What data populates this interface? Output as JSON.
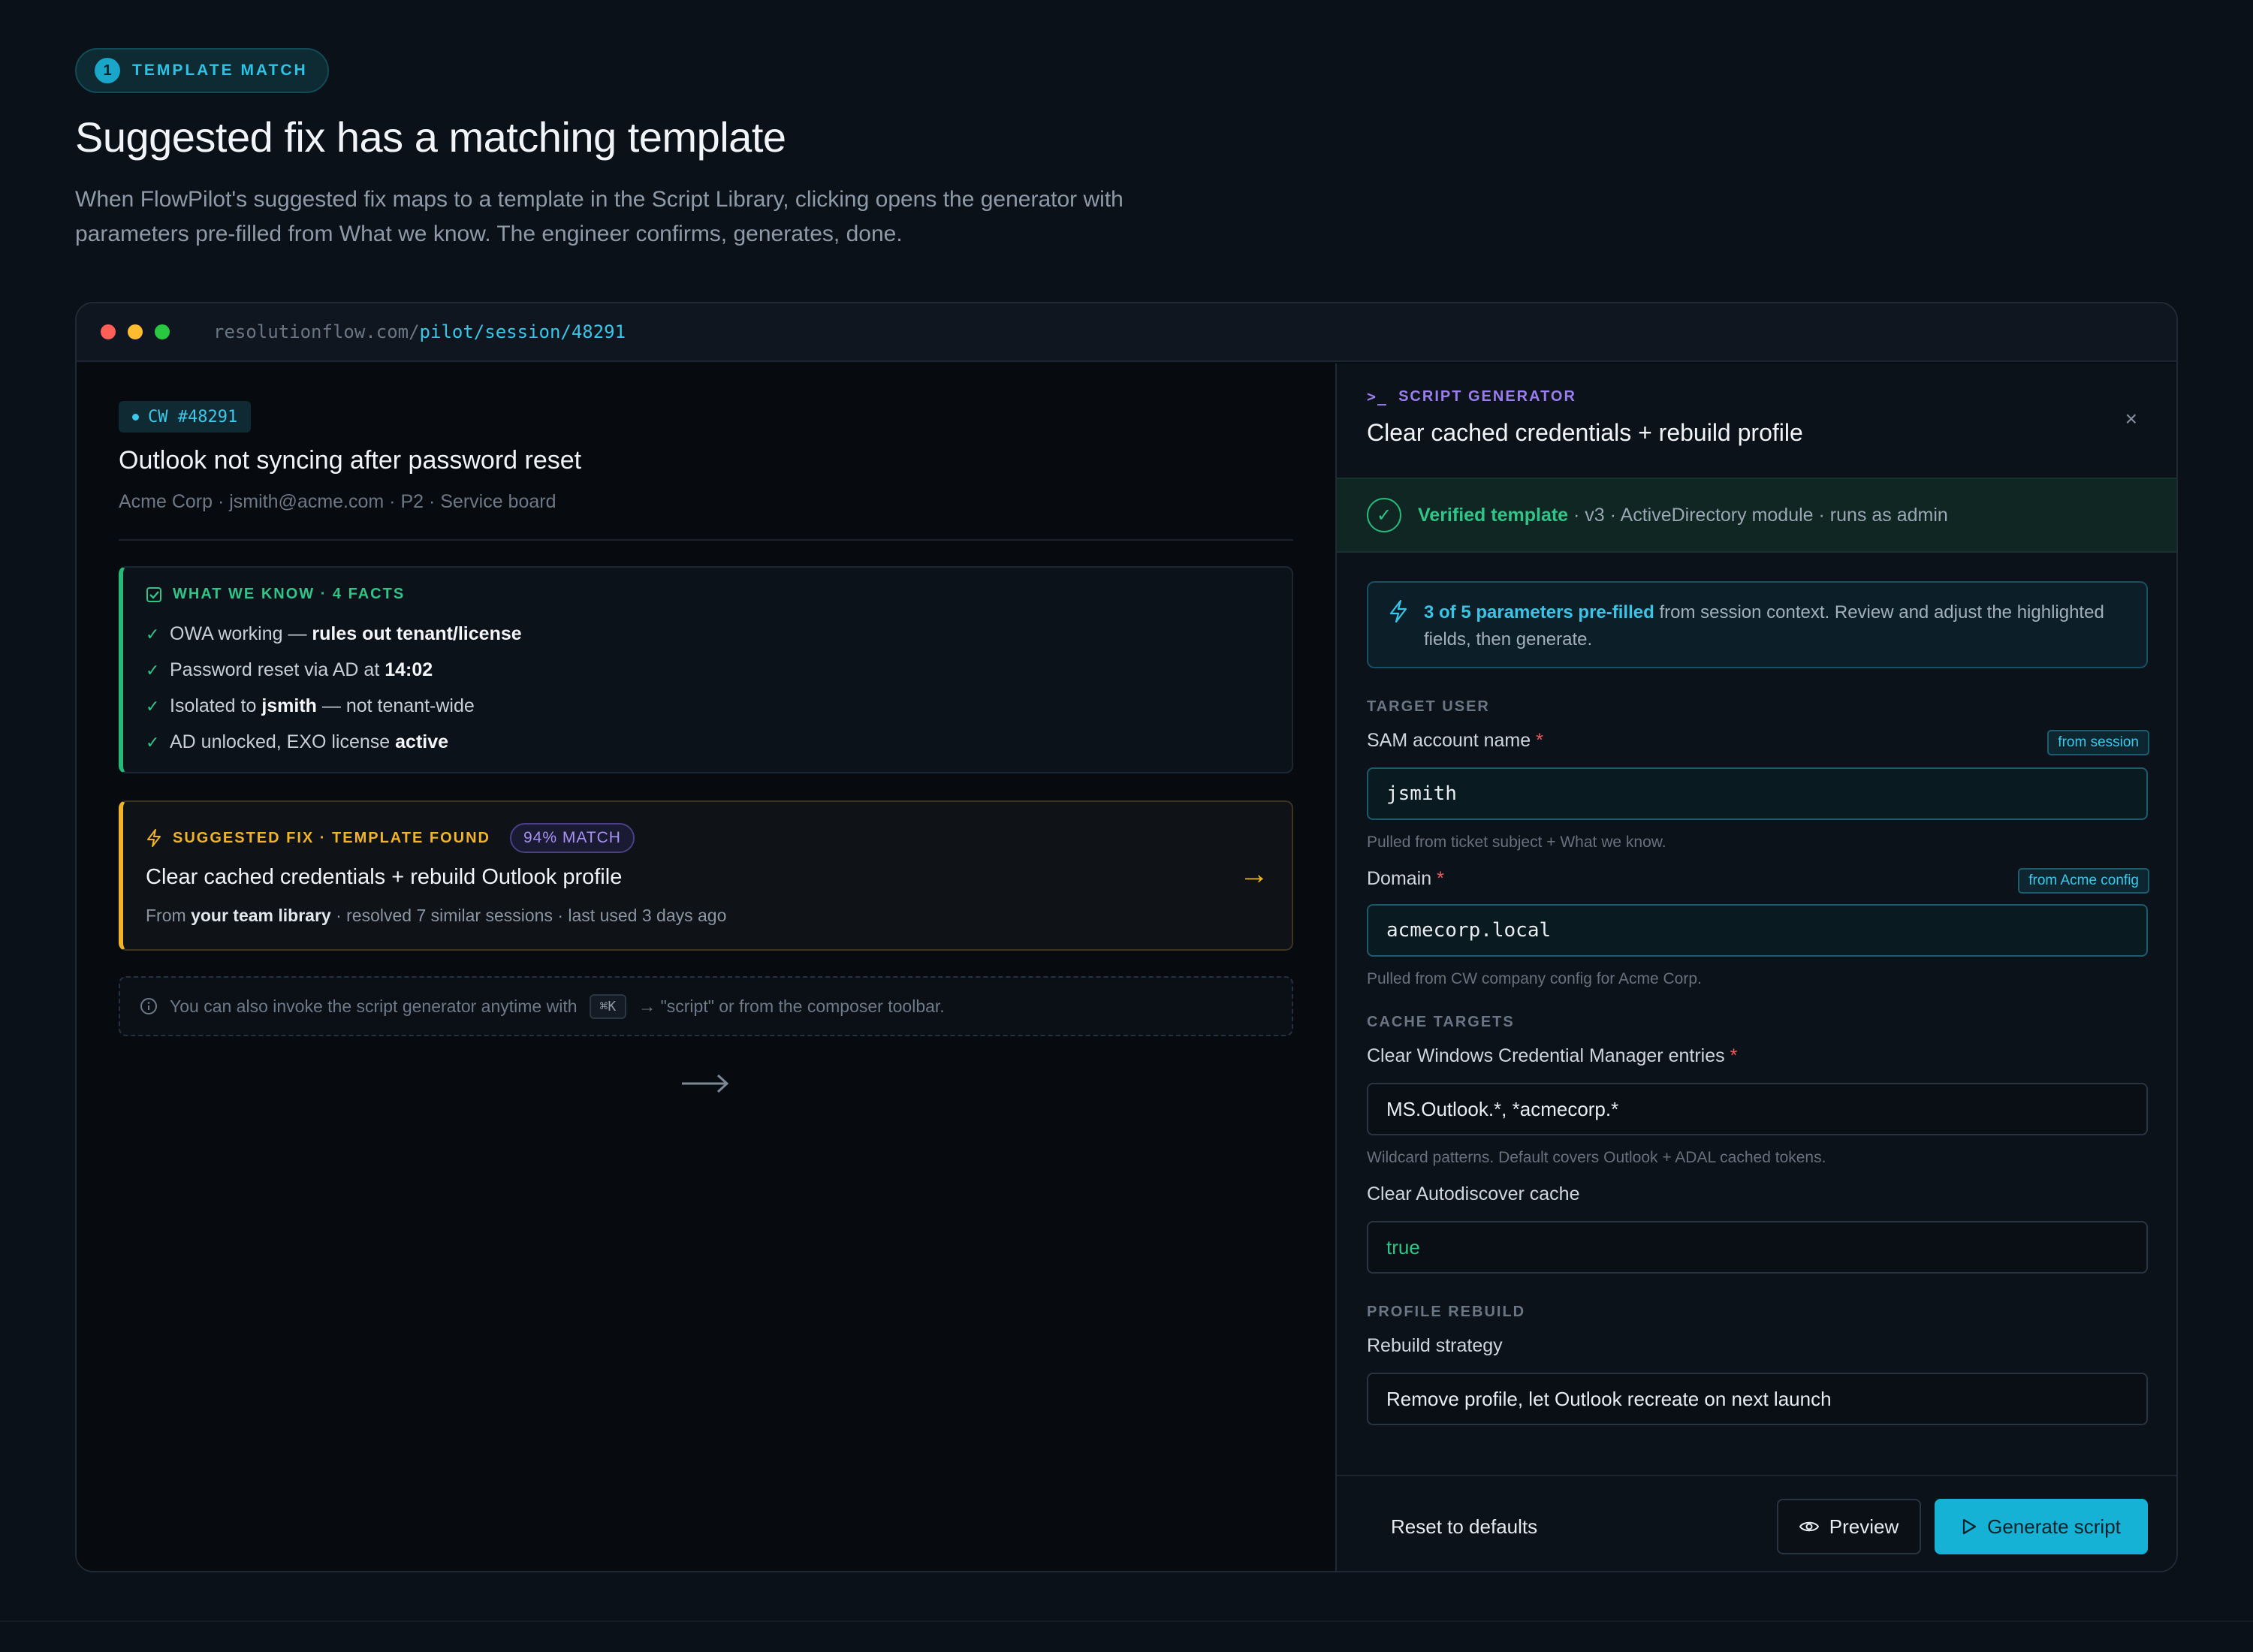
{
  "hero": {
    "step_number": "1",
    "step_label": "TEMPLATE MATCH",
    "title": "Suggested fix has a matching template",
    "description": "When FlowPilot's suggested fix maps to a template in the Script Library, clicking opens the generator with parameters pre-filled from What we know. The engineer confirms, generates, done."
  },
  "browser": {
    "url_host": "resolutionflow.com/",
    "url_path": "pilot/session/48291",
    "dot_colors": [
      "#ff5f57",
      "#febc2e",
      "#28c840"
    ]
  },
  "ticket": {
    "chip": "CW #48291",
    "title": "Outlook not syncing after password reset",
    "meta": "Acme Corp · jsmith@acme.com · P2 · Service board"
  },
  "what_we_know": {
    "heading": "WHAT WE KNOW · 4 FACTS",
    "facts": [
      {
        "text": "OWA working — ",
        "bold": "rules out tenant/license",
        "after": ""
      },
      {
        "text": "Password reset via AD at ",
        "bold": "14:02",
        "after": ""
      },
      {
        "text": "Isolated to ",
        "bold": "jsmith",
        "after": " — not tenant-wide"
      },
      {
        "text": "AD unlocked, EXO license ",
        "bold": "active",
        "after": ""
      }
    ]
  },
  "suggested_fix": {
    "label": "SUGGESTED FIX · TEMPLATE FOUND",
    "match": "94% MATCH",
    "title": "Clear cached credentials + rebuild Outlook profile",
    "meta_prefix": "From ",
    "meta_bold": "your team library",
    "meta_suffix": " · resolved 7 similar sessions · last used 3 days ago",
    "arrow": "→"
  },
  "hint": {
    "prefix": "You can also invoke the script generator anytime with",
    "kbd": "⌘K",
    "suffix": "→ \"script\" or from the composer toolbar."
  },
  "generator": {
    "label": "SCRIPT GENERATOR",
    "prompt_glyph": ">_",
    "title": "Clear cached credentials + rebuild profile",
    "close": "×",
    "verified": {
      "ok": "Verified template",
      "rest": " · v3 · ActiveDirectory module · runs as admin"
    },
    "prefill": {
      "highlight": "3 of 5 parameters pre-filled",
      "rest": " from session context. Review and adjust the highlighted fields, then generate."
    },
    "sections": {
      "target_user": "TARGET USER",
      "cache_targets": "CACHE TARGETS",
      "profile_rebuild": "PROFILE REBUILD"
    },
    "fields": {
      "sam": {
        "label": "SAM account name",
        "req": "*",
        "badge": "from session",
        "value": "jsmith",
        "help": "Pulled from ticket subject + What we know."
      },
      "domain": {
        "label": "Domain",
        "req": "*",
        "badge": "from Acme config",
        "value": "acmecorp.local",
        "help": "Pulled from CW company config for Acme Corp."
      },
      "credman": {
        "label": "Clear Windows Credential Manager entries",
        "req": "*",
        "value": "MS.Outlook.*, *acmecorp.*",
        "help": "Wildcard patterns. Default covers Outlook + ADAL cached tokens."
      },
      "autodiscover": {
        "label": "Clear Autodiscover cache",
        "value": "true"
      },
      "strategy": {
        "label": "Rebuild strategy",
        "value": "Remove profile, let Outlook recreate on next launch"
      }
    },
    "buttons": {
      "reset": "Reset to defaults",
      "preview": "Preview",
      "generate": "Generate script"
    }
  },
  "colors": {
    "accent_cyan": "#15b2d6",
    "verified_green": "#2fc588",
    "fix_amber": "#f0b429",
    "match_purple": "#a592f2",
    "required_red": "#ef5b5b"
  }
}
